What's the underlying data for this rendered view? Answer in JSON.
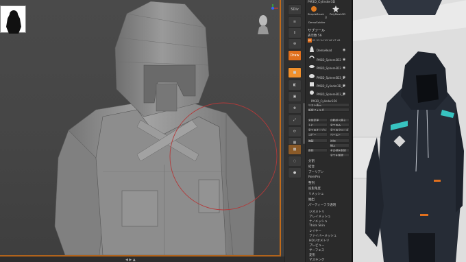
{
  "top_buttons": {
    "sdiv": "SDiv",
    "draw": "Draw"
  },
  "palette": {
    "top_label": "PM3D_Cylinder3D",
    "brush_1": "SimpleBrush",
    "brush_2": "PolyMesh3D",
    "brush_count": "3",
    "demo_label": "DemoSoldier",
    "subtool_header": "サブツール",
    "visible_count": "表示数 56",
    "levels": [
      "V1",
      "V2",
      "V3",
      "V4",
      "V5",
      "V6",
      "V7",
      "V8"
    ],
    "subtools": [
      {
        "name": "DemoHead"
      },
      {
        "name": "PM3D_Sphere3D2"
      },
      {
        "name": "PM3D_Sphere3D3"
      },
      {
        "name": "PM3D_Sphere3D3_1"
      },
      {
        "name": "PM3D_Cylinder3D_1"
      },
      {
        "name": "PM3D_Sphere3D3_2"
      },
      {
        "name": "PM3D_Cylinder3D1"
      }
    ],
    "list_all": "リスト表示",
    "new_folder": "新規フォルダ",
    "ops": [
      [
        "名前変更",
        "自動並べ替え"
      ],
      [
        "上に",
        "全てのみ"
      ],
      [
        "全てのオープン",
        "全てのクローズ"
      ],
      [
        "コピー",
        "ペースト"
      ],
      [
        "複製",
        "追加"
      ],
      [
        "",
        "挿入"
      ],
      [
        "削除",
        "その他を削除"
      ],
      [
        "",
        "全てを削除"
      ]
    ],
    "menu_1": [
      "分割",
      "結合",
      "ブーリアン",
      "RemPro",
      "整列",
      "投影角度",
      "リメッシュ",
      "抽出",
      "パーティーフラ透明"
    ],
    "menu_2": [
      "ジオメトリ",
      "アレイメッシュ",
      "ナノメッシュ",
      "Thick Skin",
      "レイヤー",
      "ファイバーメッシュ",
      "HDジオメトリ",
      "プレビュー",
      "サーフェス",
      "変形",
      "マスキング"
    ]
  },
  "colors": {
    "accent": "#e0701e",
    "viewport_bg": "#474747",
    "brush_circle": "#b23a3a"
  }
}
